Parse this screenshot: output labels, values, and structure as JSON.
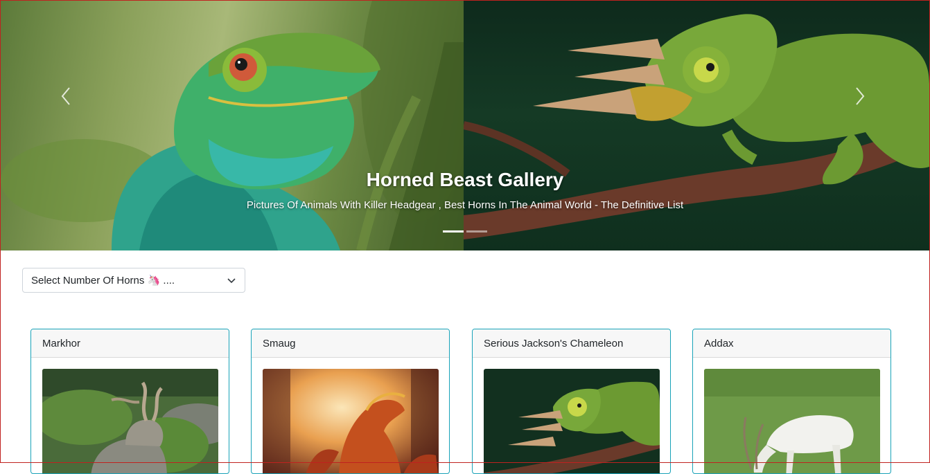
{
  "carousel": {
    "title": "Horned Beast Gallery",
    "subtitle": "Pictures Of Animals With Killer Headgear , Best Horns In The Animal World - The Definitive List",
    "indicators": 2,
    "active_index": 0
  },
  "filter": {
    "label": "Select Number Of Horns 🦄 ....",
    "icon": "chevron-down-icon"
  },
  "cards": [
    {
      "title": "Markhor"
    },
    {
      "title": "Smaug"
    },
    {
      "title": "Serious Jackson's Chameleon"
    },
    {
      "title": "Addax"
    }
  ],
  "colors": {
    "card_border": "#17a2b8",
    "frame_border": "#c0211f"
  }
}
